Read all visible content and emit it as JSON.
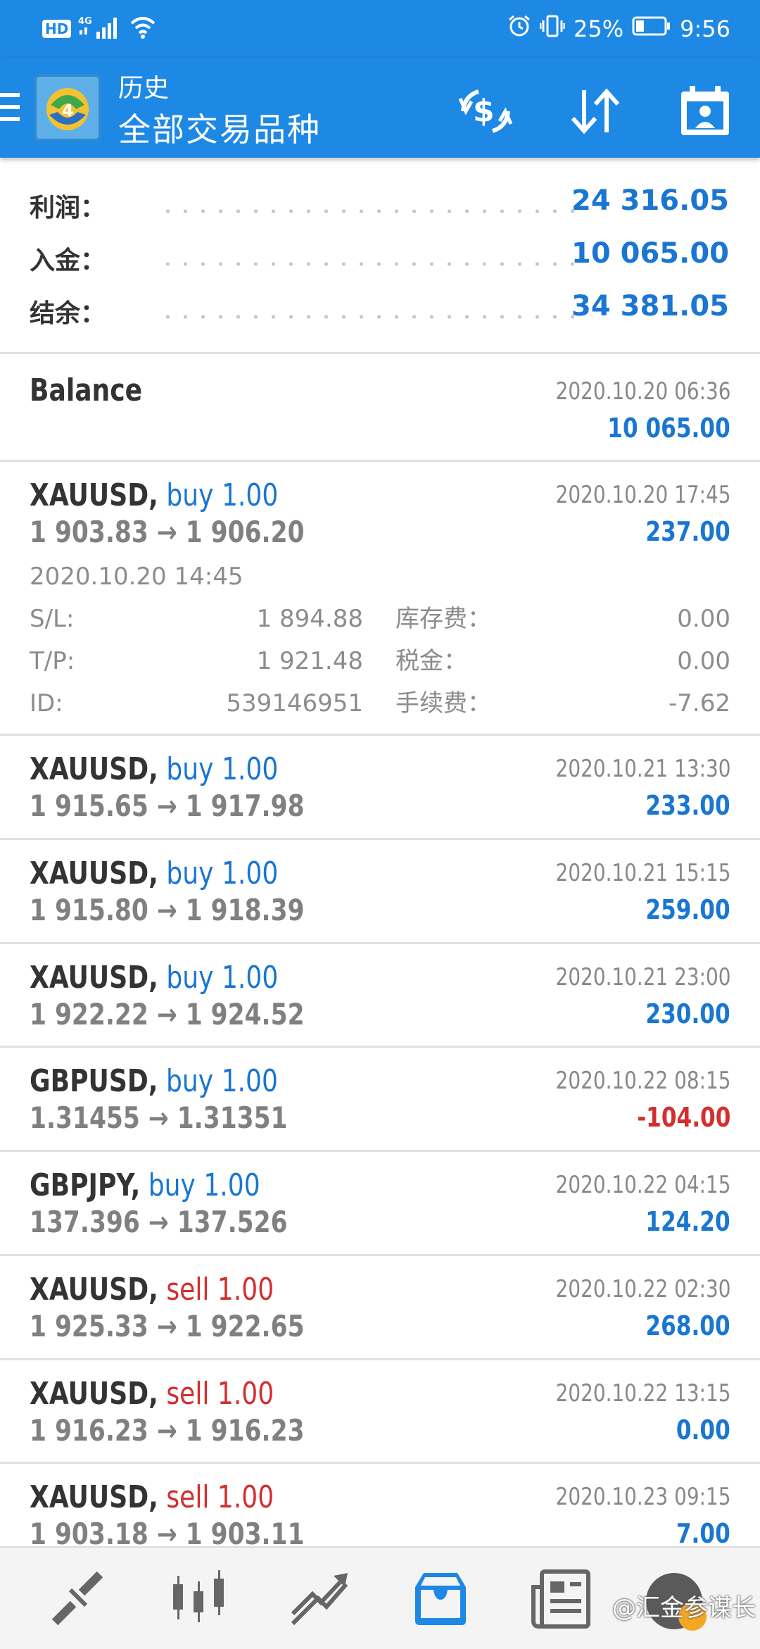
{
  "status_bar": {
    "hd": "HD",
    "network": "4G",
    "battery": "25%",
    "time": "9:56"
  },
  "app_bar": {
    "title": "历史",
    "subtitle": "全部交易品种",
    "icons": [
      "menu-icon",
      "metatrader-logo",
      "currency-exchange-icon",
      "sort-icon",
      "calendar-icon"
    ]
  },
  "summary": {
    "profit_label": "利润：",
    "profit_value": "24 316.05",
    "deposit_label": "入金：",
    "deposit_value": "10 065.00",
    "balance_label": "结余：",
    "balance_value": "34 381.05"
  },
  "balance_entry": {
    "label": "Balance",
    "time": "2020.10.20 06:36",
    "amount": "10 065.00"
  },
  "deals": [
    {
      "symbol": "XAUUSD,",
      "side": "buy 1.00",
      "side_type": "buy",
      "prices": "1 903.83 → 1 906.20",
      "time": "2020.10.20 17:45",
      "profit": "237.00"
    },
    {
      "symbol": "XAUUSD,",
      "side": "buy 1.00",
      "side_type": "buy",
      "prices": "1 915.65 → 1 917.98",
      "time": "2020.10.21 13:30",
      "profit": "233.00"
    },
    {
      "symbol": "XAUUSD,",
      "side": "buy 1.00",
      "side_type": "buy",
      "prices": "1 915.80 → 1 918.39",
      "time": "2020.10.21 15:15",
      "profit": "259.00"
    },
    {
      "symbol": "XAUUSD,",
      "side": "buy 1.00",
      "side_type": "buy",
      "prices": "1 922.22 → 1 924.52",
      "time": "2020.10.21 23:00",
      "profit": "230.00"
    },
    {
      "symbol": "GBPUSD,",
      "side": "buy 1.00",
      "side_type": "buy",
      "prices": "1.31455 → 1.31351",
      "time": "2020.10.22 08:15",
      "profit": "-104.00"
    },
    {
      "symbol": "GBPJPY,",
      "side": "buy 1.00",
      "side_type": "buy",
      "prices": "137.396 → 137.526",
      "time": "2020.10.22 04:15",
      "profit": "124.20"
    },
    {
      "symbol": "XAUUSD,",
      "side": "sell 1.00",
      "side_type": "sell",
      "prices": "1 925.33 → 1 922.65",
      "time": "2020.10.22 02:30",
      "profit": "268.00"
    },
    {
      "symbol": "XAUUSD,",
      "side": "sell 1.00",
      "side_type": "sell",
      "prices": "1 916.23 → 1 916.23",
      "time": "2020.10.22 13:15",
      "profit": "0.00"
    },
    {
      "symbol": "XAUUSD,",
      "side": "sell 1.00",
      "side_type": "sell",
      "prices": "1 903.18 → 1 903.11",
      "time": "2020.10.23 09:15",
      "profit": "7.00"
    }
  ],
  "deal_details": {
    "open_time": "2020.10.20 14:45",
    "sl_label": "S/L:",
    "sl_value": "1 894.88",
    "tp_label": "T/P:",
    "tp_value": "1 921.48",
    "id_label": "ID:",
    "id_value": "539146951",
    "swap_label": "库存费：",
    "swap_value": "0.00",
    "tax_label": "税金：",
    "tax_value": "0.00",
    "fee_label": "手续费：",
    "fee_value": "-7.62"
  },
  "bottom_nav": {
    "items": [
      "quotes-icon",
      "chart-icon",
      "trade-icon",
      "history-icon",
      "news-icon"
    ],
    "active": "history-icon"
  },
  "watermark": "@汇金参谋长",
  "colors": {
    "primary": "#1e88e5",
    "buy": "#1976d2",
    "sell": "#d32f2f",
    "muted": "#888888"
  }
}
